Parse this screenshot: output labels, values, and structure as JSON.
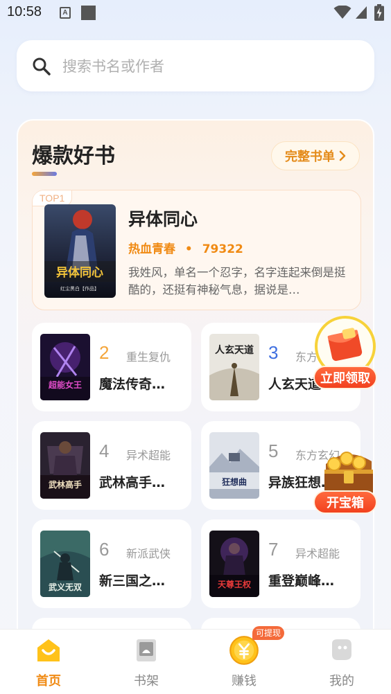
{
  "status_bar": {
    "time": "10:58",
    "notif_letter": "A"
  },
  "search": {
    "placeholder": "搜索书名或作者"
  },
  "hot_section": {
    "title": "爆款好书",
    "full_list_label": "完整书单",
    "top1": {
      "badge": "TOP1",
      "title": "异体同心",
      "cover_title": "异体同心",
      "cover_author": "红尘黑白【作品】",
      "genre": "热血青春",
      "separator": "•",
      "count": "79322",
      "description": "我姓风，单名一个忍字，名字连起来倒是挺酷的，还挺有神秘气息，据说是…"
    },
    "books": [
      {
        "rank": "2",
        "genre": "重生复仇",
        "title": "魔法传奇…",
        "cover_title": "超能女王"
      },
      {
        "rank": "3",
        "genre": "东方玄幻",
        "title": "人玄天道…",
        "cover_title": "人玄天道"
      },
      {
        "rank": "4",
        "genre": "异术超能",
        "title": "武林高手…",
        "cover_title": "武林高手"
      },
      {
        "rank": "5",
        "genre": "东方玄幻",
        "title": "异族狂想…",
        "cover_title": "狂想曲"
      },
      {
        "rank": "6",
        "genre": "新派武侠",
        "title": "新三国之…",
        "cover_title": "武义无双"
      },
      {
        "rank": "7",
        "genre": "异术超能",
        "title": "重登巅峰…",
        "cover_title": "天尊王权"
      }
    ]
  },
  "floating": {
    "redpacket_label": "立即领取",
    "chest_label": "开宝箱"
  },
  "bottom_nav": {
    "items": [
      {
        "label": "首页"
      },
      {
        "label": "书架"
      },
      {
        "label": "赚钱",
        "badge": "可提现"
      },
      {
        "label": "我的"
      }
    ]
  },
  "colors": {
    "accent_orange": "#f08a13",
    "rank_orange": "#f4a53a",
    "rank_blue": "#3f6fe0",
    "rank_gray": "#999999",
    "cta_red": "#f2411e"
  }
}
